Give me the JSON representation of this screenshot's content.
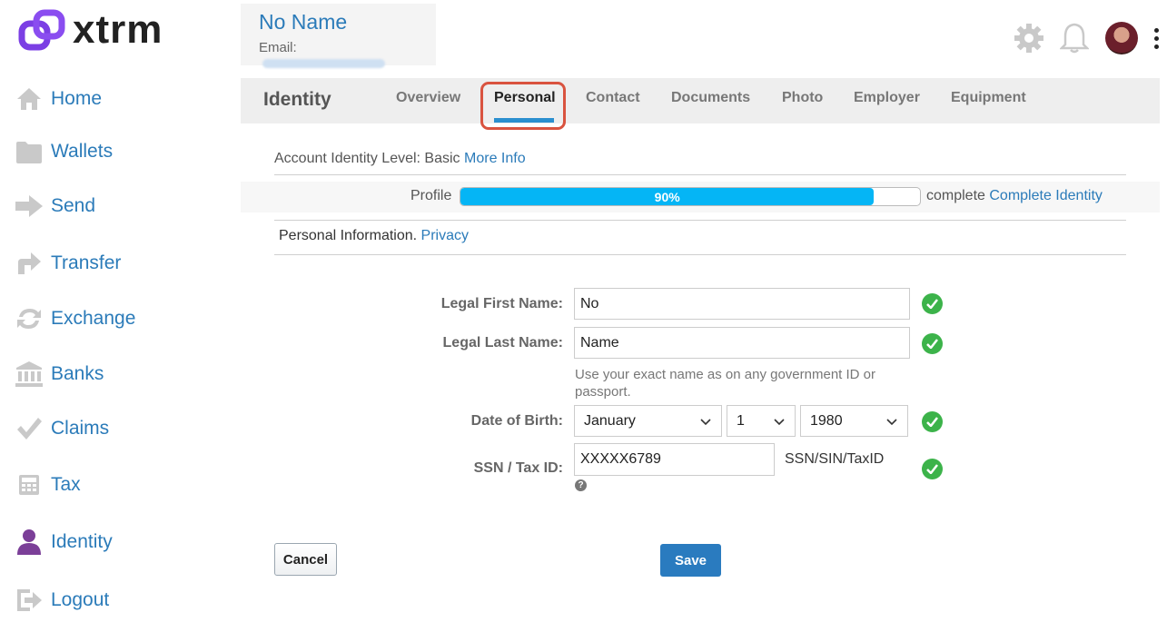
{
  "brand": {
    "name": "xtrm",
    "accent": "#7b3fe4"
  },
  "sidebar": {
    "items": [
      {
        "label": "Home",
        "icon": "home-icon"
      },
      {
        "label": "Wallets",
        "icon": "folder-icon"
      },
      {
        "label": "Send",
        "icon": "arrow-right-icon"
      },
      {
        "label": "Transfer",
        "icon": "transfer-arrow-icon"
      },
      {
        "label": "Exchange",
        "icon": "exchange-icon"
      },
      {
        "label": "Banks",
        "icon": "bank-icon"
      },
      {
        "label": "Claims",
        "icon": "checkmark-icon"
      },
      {
        "label": "Tax",
        "icon": "calculator-icon"
      },
      {
        "label": "Identity",
        "icon": "user-icon"
      },
      {
        "label": "Logout",
        "icon": "logout-icon"
      }
    ]
  },
  "header": {
    "user_name": "No Name",
    "email_label": "Email:",
    "icons": [
      "gear-icon",
      "bell-icon",
      "avatar",
      "more-vertical-icon"
    ]
  },
  "tabs": {
    "title": "Identity",
    "items": [
      "Overview",
      "Personal",
      "Contact",
      "Documents",
      "Photo",
      "Employer",
      "Equipment"
    ],
    "active": "Personal"
  },
  "account_level": {
    "text": "Account Identity Level: Basic",
    "link": "More Info"
  },
  "profile": {
    "label": "Profile",
    "percent_text": "90%",
    "percent": 0.9,
    "complete_text": "complete",
    "link": "Complete Identity"
  },
  "personal_info": {
    "text": "Personal Information.",
    "link": "Privacy"
  },
  "form": {
    "first_name_label": "Legal First Name:",
    "first_name_value": "No",
    "last_name_label": "Legal Last Name:",
    "last_name_value": "Name",
    "name_hint": "Use your exact name as on any government ID or passport.",
    "dob_label": "Date of Birth:",
    "dob_month": "January",
    "dob_day": "1",
    "dob_year": "1980",
    "ssn_label": "SSN / Tax ID:",
    "ssn_value": "XXXXX6789",
    "ssn_suffix": "SSN/SIN/TaxID"
  },
  "actions": {
    "cancel": "Cancel",
    "save": "Save"
  }
}
